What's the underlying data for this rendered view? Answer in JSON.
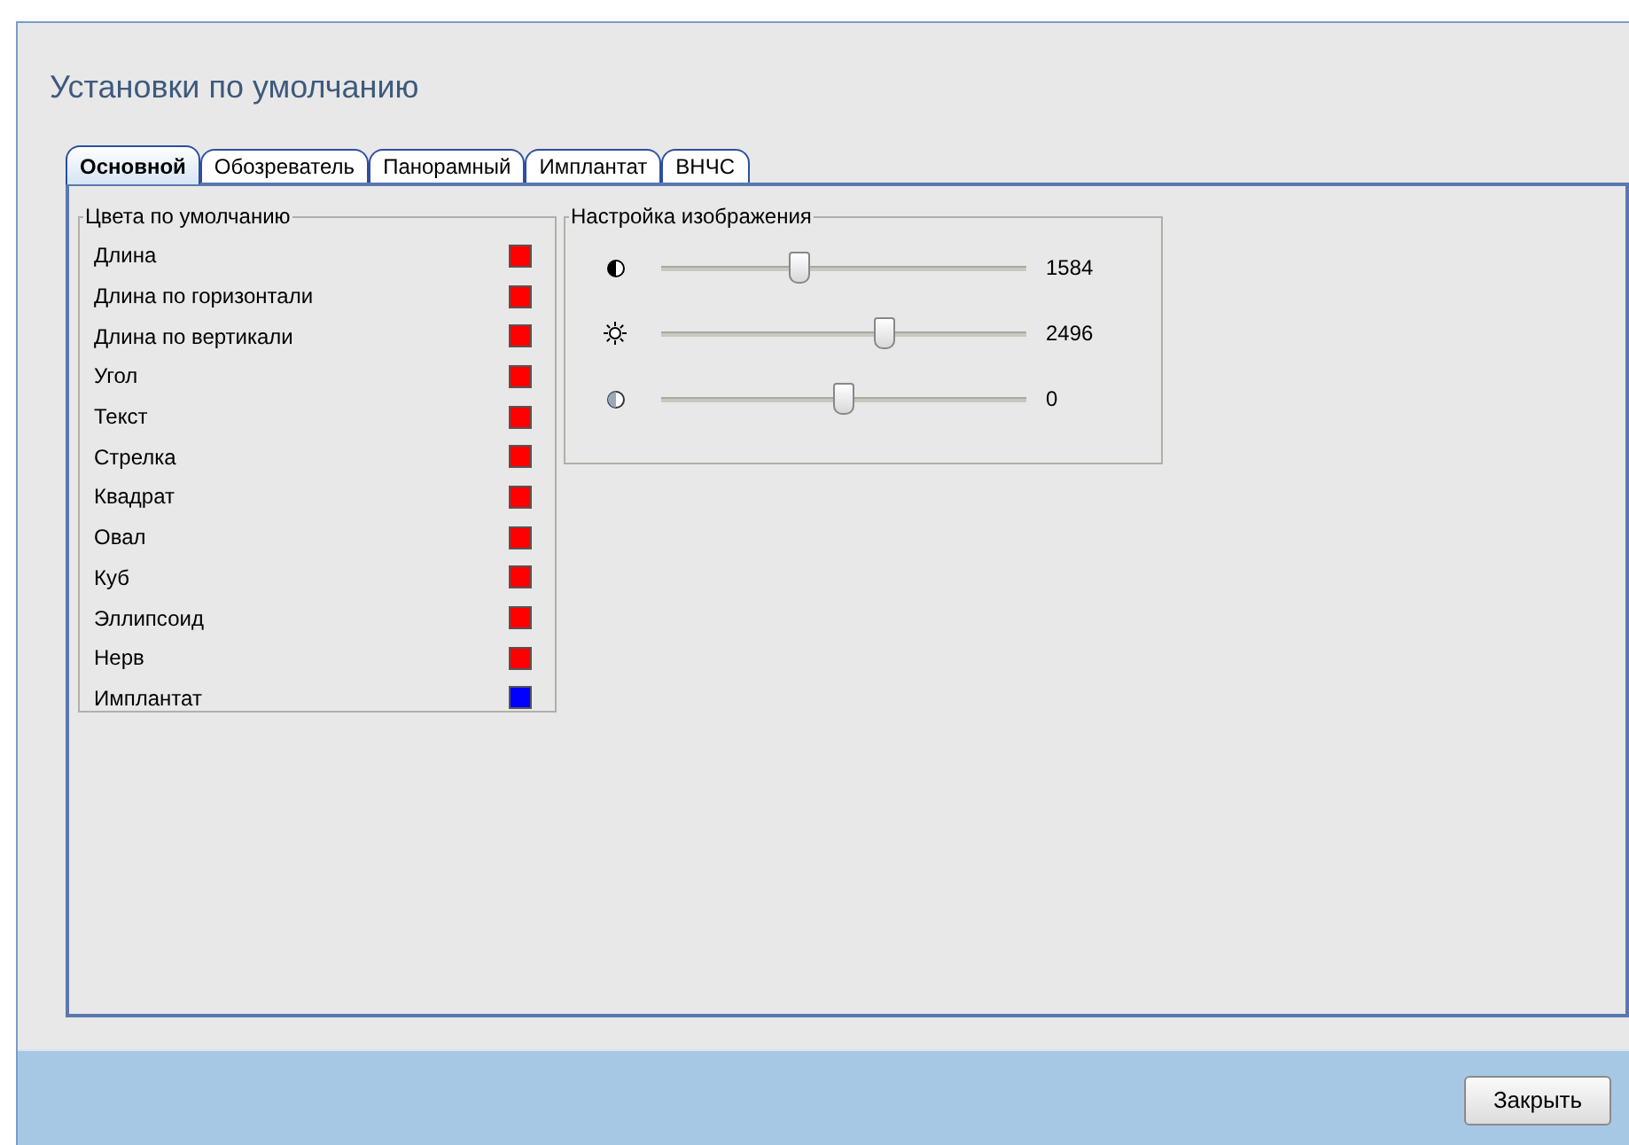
{
  "window": {
    "title": "Установки по умолчанию"
  },
  "tabs": [
    {
      "label": "Основной",
      "selected": true
    },
    {
      "label": "Обозреватель",
      "selected": false
    },
    {
      "label": "Панорамный",
      "selected": false
    },
    {
      "label": "Имплантат",
      "selected": false
    },
    {
      "label": "ВНЧС",
      "selected": false
    }
  ],
  "colors_group": {
    "title": "Цвета по умолчанию",
    "items": [
      {
        "label": "Длина",
        "color": "#ff0000"
      },
      {
        "label": "Длина по горизонтали",
        "color": "#ff0000"
      },
      {
        "label": "Длина по вертикали",
        "color": "#ff0000"
      },
      {
        "label": "Угол",
        "color": "#ff0000"
      },
      {
        "label": "Текст",
        "color": "#ff0000"
      },
      {
        "label": "Стрелка",
        "color": "#ff0000"
      },
      {
        "label": "Квадрат",
        "color": "#ff0000"
      },
      {
        "label": "Овал",
        "color": "#ff0000"
      },
      {
        "label": "Куб",
        "color": "#ff0000"
      },
      {
        "label": "Эллипсоид",
        "color": "#ff0000"
      },
      {
        "label": "Нерв",
        "color": "#ff0000"
      },
      {
        "label": "Имплантат",
        "color": "#0000ff"
      }
    ]
  },
  "image_group": {
    "title": "Настройка изображения",
    "sliders": [
      {
        "kind": "contrast",
        "level": 0.38,
        "reading": "1584"
      },
      {
        "kind": "brightness",
        "level": 0.61,
        "reading": "2496"
      },
      {
        "kind": "gamma",
        "level": 0.5,
        "reading": "0"
      }
    ]
  },
  "buttons": [
    "Закрыть"
  ]
}
